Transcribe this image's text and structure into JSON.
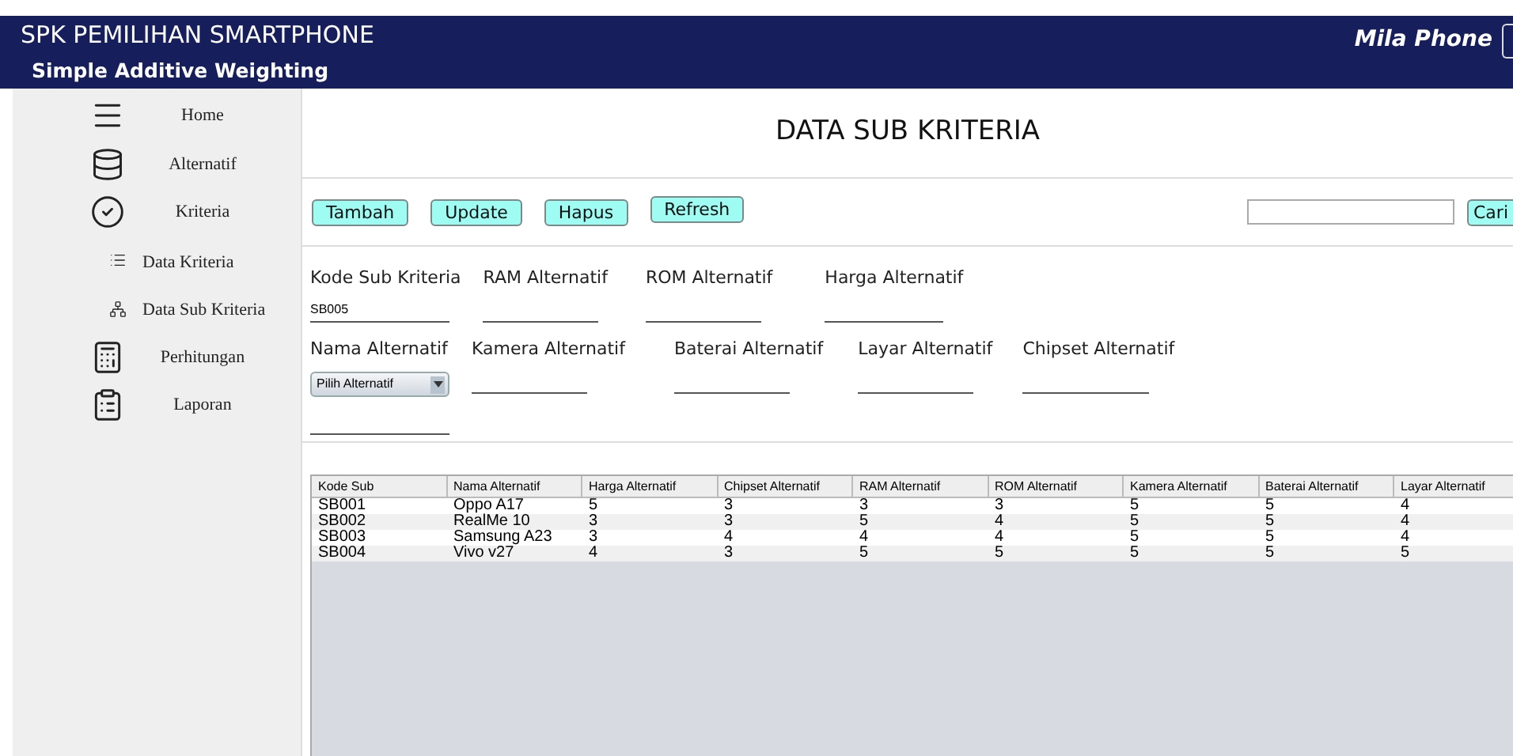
{
  "header": {
    "title": "SPK PEMILIHAN SMARTPHONE",
    "subtitle": "Simple Additive Weighting",
    "brand": "Mila Phone"
  },
  "sidebar": {
    "items": [
      {
        "label": "Home"
      },
      {
        "label": "Alternatif"
      },
      {
        "label": "Kriteria",
        "children": [
          {
            "label": "Data Kriteria"
          },
          {
            "label": "Data Sub Kriteria"
          }
        ]
      },
      {
        "label": "Perhitungan"
      },
      {
        "label": "Laporan"
      }
    ]
  },
  "page_title": "DATA SUB KRITERIA",
  "buttons": [
    "Tambah",
    "Update",
    "Hapus",
    "Refresh"
  ],
  "search": {
    "button": "Cari"
  },
  "form": {
    "rows": [
      [
        {
          "kind": "text",
          "label": "Kode Sub Kriteria",
          "value": "SB005"
        },
        {
          "kind": "text",
          "label": "RAM Alternatif"
        },
        {
          "kind": "text",
          "label": "ROM Alternatif"
        },
        {
          "kind": "text",
          "label": "Harga Alternatif"
        }
      ],
      [
        {
          "kind": "select",
          "label": "Nama Alternatif",
          "value": "Pilih Alternatif"
        },
        {
          "kind": "text",
          "label": "Kamera Alternatif"
        },
        {
          "kind": "text",
          "label": "Baterai Alternatif"
        },
        {
          "kind": "text",
          "label": "Layar Alternatif"
        },
        {
          "kind": "text",
          "label": "Chipset Alternatif"
        }
      ]
    ]
  },
  "table": {
    "columns": [
      "Kode Sub",
      "Nama Alternatif",
      "Harga Alternatif",
      "Chipset Alternatif",
      "RAM Alternatif",
      "ROM Alternatif",
      "Kamera Alternatif",
      "Baterai Alternatif",
      "Layar Alternatif"
    ],
    "rows": [
      [
        "SB001",
        "Oppo A17",
        "5",
        "3",
        "3",
        "3",
        "5",
        "5",
        "4"
      ],
      [
        "SB002",
        "RealMe 10",
        "3",
        "3",
        "5",
        "4",
        "5",
        "5",
        "4"
      ],
      [
        "SB003",
        "Samsung A23",
        "3",
        "4",
        "4",
        "4",
        "5",
        "5",
        "4"
      ],
      [
        "SB004",
        "Vivo v27",
        "4",
        "3",
        "5",
        "5",
        "5",
        "5",
        "5"
      ]
    ]
  }
}
